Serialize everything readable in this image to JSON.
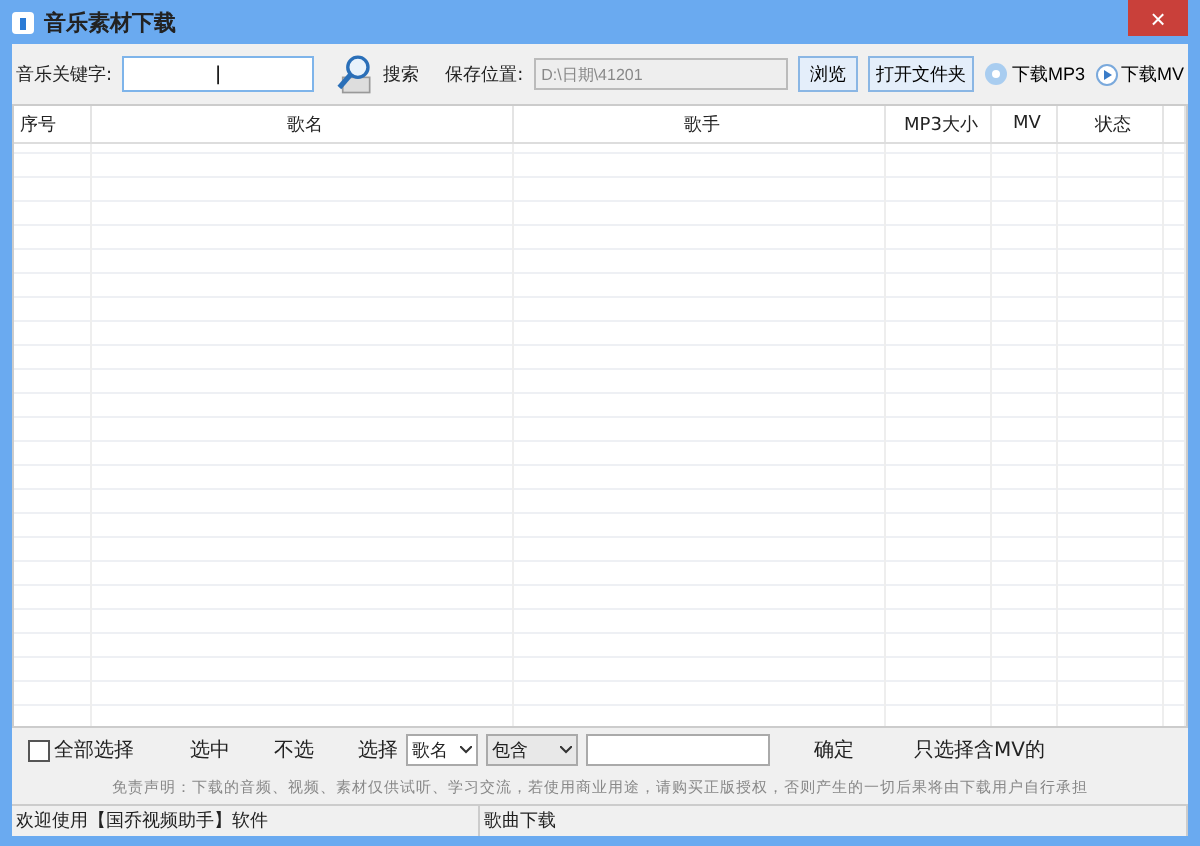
{
  "window": {
    "title": "音乐素材下载",
    "close": "×"
  },
  "toolbar": {
    "keyword_label": "音乐关键字:",
    "keyword_value": "|",
    "search_label": "搜索",
    "save_label": "保存位置:",
    "save_path": "D:\\日期\\41201",
    "browse": "浏览",
    "open_folder": "打开文件夹",
    "download_mp3": "下载MP3",
    "download_mv": "下载MV"
  },
  "table": {
    "columns": [
      "序号",
      "歌名",
      "歌手",
      "MP3大小",
      "MV",
      "状态"
    ]
  },
  "filter": {
    "select_all": {
      "label": "全部选择",
      "checked": false
    },
    "select": "选中",
    "deselect": "不选",
    "choose_label": "选择",
    "field": "歌名",
    "match": "包含",
    "confirm": "确定",
    "only_mv": "只选择含MV的"
  },
  "disclaimer": "免责声明：下载的音频、视频、素材仅供试听、学习交流，若使用商业用途，请购买正版授权，否则产生的一切后果将由下载用户自行承担",
  "status_bar": [
    "欢迎使用【国乔视频助手】软件",
    "歌曲下载"
  ]
}
